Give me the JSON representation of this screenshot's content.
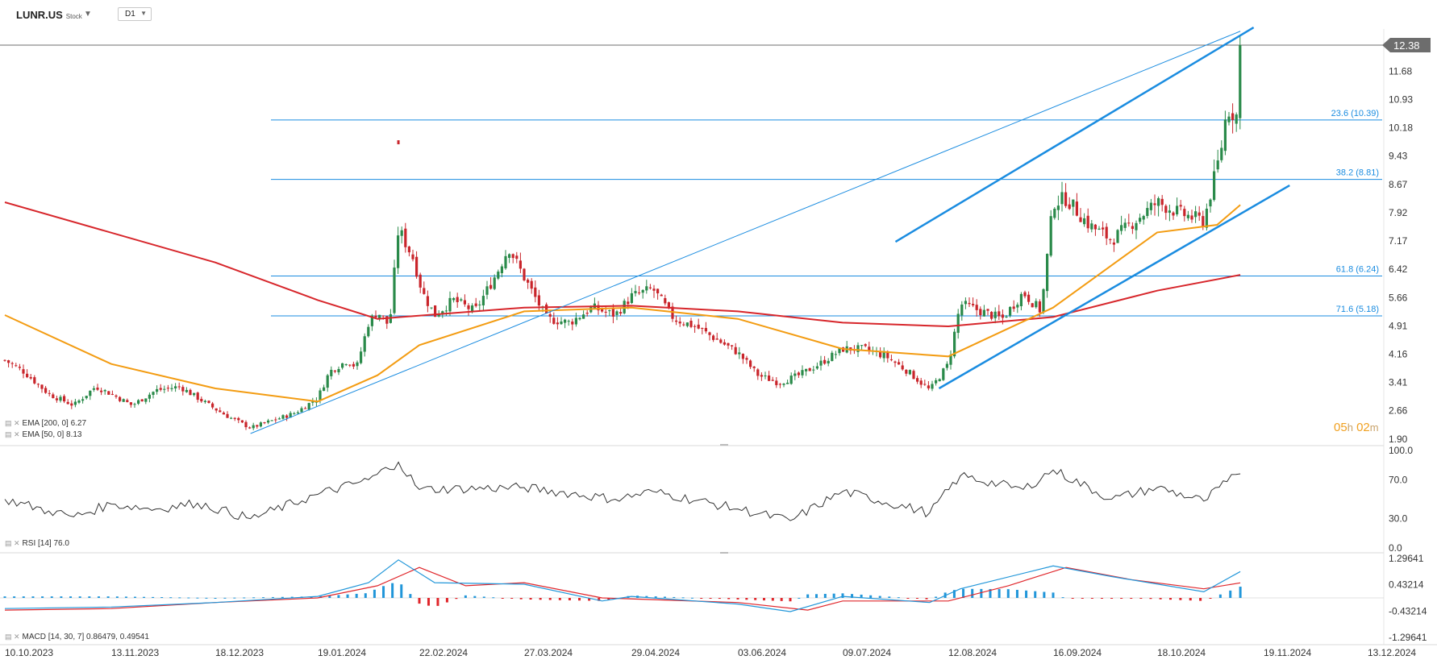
{
  "header": {
    "symbol": "LUNR.US",
    "instrument_type": "Stock",
    "timeframe": "D1",
    "caret_icon": "chevron-down-icon"
  },
  "indicators": {
    "ema200_label": "EMA [200, 0] 6.27",
    "ema50_label": "EMA [50, 0] 8.13",
    "rsi_label": "RSI [14] 76.0",
    "macd_label": "MACD [14, 30, 7] 0.86479, 0.49541"
  },
  "countdown": {
    "hours": "05",
    "h": "h",
    "minutes": "02",
    "m": "m"
  },
  "colors": {
    "up": "#2a8a4a",
    "down": "#c9252b",
    "ema200": "#d7262b",
    "ema50": "#f39c12",
    "trendline": "#1a8ce0",
    "fib_line": "#1a8ce0",
    "rsi_line": "#333333",
    "macd_line": "#2196d9",
    "signal_line": "#e0262b",
    "price_tag_bg": "#6d6d6d"
  },
  "chart_data": [
    {
      "panel": "price",
      "type": "candlestick",
      "title": "LUNR.US",
      "y_ticks": [
        "12.38",
        "11.68",
        "10.93",
        "10.18",
        "9.43",
        "8.67",
        "7.92",
        "7.17",
        "6.42",
        "5.66",
        "4.91",
        "4.16",
        "3.41",
        "2.66",
        "1.90"
      ],
      "ylim": [
        1.9,
        12.75
      ],
      "current_price": "12.38",
      "x_ticks": [
        "10.10.2023",
        "13.11.2023",
        "18.12.2023",
        "19.01.2024",
        "22.02.2024",
        "27.03.2024",
        "29.04.2024",
        "03.06.2024",
        "09.07.2024",
        "12.08.2024",
        "16.09.2024",
        "18.10.2024",
        "19.11.2024",
        "13.12.2024"
      ],
      "fibonacci": [
        {
          "label": "23.6 (10.39)",
          "price": 10.39
        },
        {
          "label": "38.2 (8.81)",
          "price": 8.81
        },
        {
          "label": "61.8 (6.24)",
          "price": 6.24
        },
        {
          "label": "71.6 (5.18)",
          "price": 5.18
        }
      ],
      "close_path": [
        [
          "10.10.2023",
          4.0
        ],
        [
          "16.10.2023",
          3.7
        ],
        [
          "24.10.2023",
          3.1
        ],
        [
          "01.11.2023",
          2.8
        ],
        [
          "08.11.2023",
          3.3
        ],
        [
          "13.11.2023",
          3.1
        ],
        [
          "20.11.2023",
          2.8
        ],
        [
          "28.11.2023",
          3.2
        ],
        [
          "06.12.2023",
          3.3
        ],
        [
          "12.12.2023",
          3.0
        ],
        [
          "18.12.2023",
          2.7
        ],
        [
          "22.12.2023",
          2.5
        ],
        [
          "29.12.2023",
          2.2
        ],
        [
          "05.01.2024",
          2.4
        ],
        [
          "12.01.2024",
          2.6
        ],
        [
          "19.01.2024",
          3.0
        ],
        [
          "23.01.2024",
          3.7
        ],
        [
          "29.01.2024",
          4.0
        ],
        [
          "01.02.2024",
          3.8
        ],
        [
          "05.02.2024",
          5.0
        ],
        [
          "08.02.2024",
          5.3
        ],
        [
          "12.02.2024",
          4.9
        ],
        [
          "15.02.2024",
          7.5
        ],
        [
          "20.02.2024",
          6.7
        ],
        [
          "23.02.2024",
          5.8
        ],
        [
          "27.02.2024",
          5.2
        ],
        [
          "04.03.2024",
          5.6
        ],
        [
          "11.03.2024",
          5.3
        ],
        [
          "18.03.2024",
          6.3
        ],
        [
          "22.03.2024",
          7.0
        ],
        [
          "27.03.2024",
          6.2
        ],
        [
          "03.04.2024",
          5.1
        ],
        [
          "10.04.2024",
          5.0
        ],
        [
          "17.04.2024",
          5.4
        ],
        [
          "24.04.2024",
          5.2
        ],
        [
          "29.04.2024",
          5.7
        ],
        [
          "06.05.2024",
          5.9
        ],
        [
          "13.05.2024",
          5.1
        ],
        [
          "20.05.2024",
          4.9
        ],
        [
          "03.06.2024",
          4.2
        ],
        [
          "10.06.2024",
          3.6
        ],
        [
          "17.06.2024",
          3.4
        ],
        [
          "24.06.2024",
          3.6
        ],
        [
          "01.07.2024",
          3.9
        ],
        [
          "09.07.2024",
          4.3
        ],
        [
          "16.07.2024",
          4.3
        ],
        [
          "23.07.2024",
          4.1
        ],
        [
          "30.07.2024",
          3.7
        ],
        [
          "06.08.2024",
          3.2
        ],
        [
          "12.08.2024",
          3.9
        ],
        [
          "16.08.2024",
          5.5
        ],
        [
          "23.08.2024",
          5.3
        ],
        [
          "30.08.2024",
          5.1
        ],
        [
          "06.09.2024",
          5.8
        ],
        [
          "12.09.2024",
          5.3
        ],
        [
          "16.09.2024",
          8.2
        ],
        [
          "20.09.2024",
          8.3
        ],
        [
          "27.09.2024",
          7.6
        ],
        [
          "04.10.2024",
          7.2
        ],
        [
          "11.10.2024",
          7.7
        ],
        [
          "18.10.2024",
          8.2
        ],
        [
          "25.10.2024",
          7.9
        ],
        [
          "01.11.2024",
          7.7
        ],
        [
          "06.11.2024",
          9.5
        ],
        [
          "08.11.2024",
          10.7
        ],
        [
          "11.11.2024",
          10.5
        ],
        [
          "12.11.2024",
          12.38
        ]
      ],
      "series": [
        {
          "name": "EMA [200, 0]",
          "last": 6.27
        },
        {
          "name": "EMA [50, 0]",
          "last": 8.13
        }
      ]
    },
    {
      "panel": "rsi",
      "type": "line",
      "series": [
        {
          "name": "RSI [14]",
          "last": 76.0
        }
      ],
      "y_ticks": [
        "100.0",
        "70.0",
        "30.0",
        "0.0"
      ],
      "ylim": [
        0,
        100
      ]
    },
    {
      "panel": "macd",
      "type": "line",
      "series": [
        {
          "name": "MACD",
          "last": 0.86479
        },
        {
          "name": "Signal",
          "last": 0.49541
        }
      ],
      "y_ticks": [
        "1.29641",
        "0.43214",
        "-0.43214",
        "-1.29641"
      ],
      "ylim": [
        -1.29641,
        1.29641
      ]
    }
  ]
}
